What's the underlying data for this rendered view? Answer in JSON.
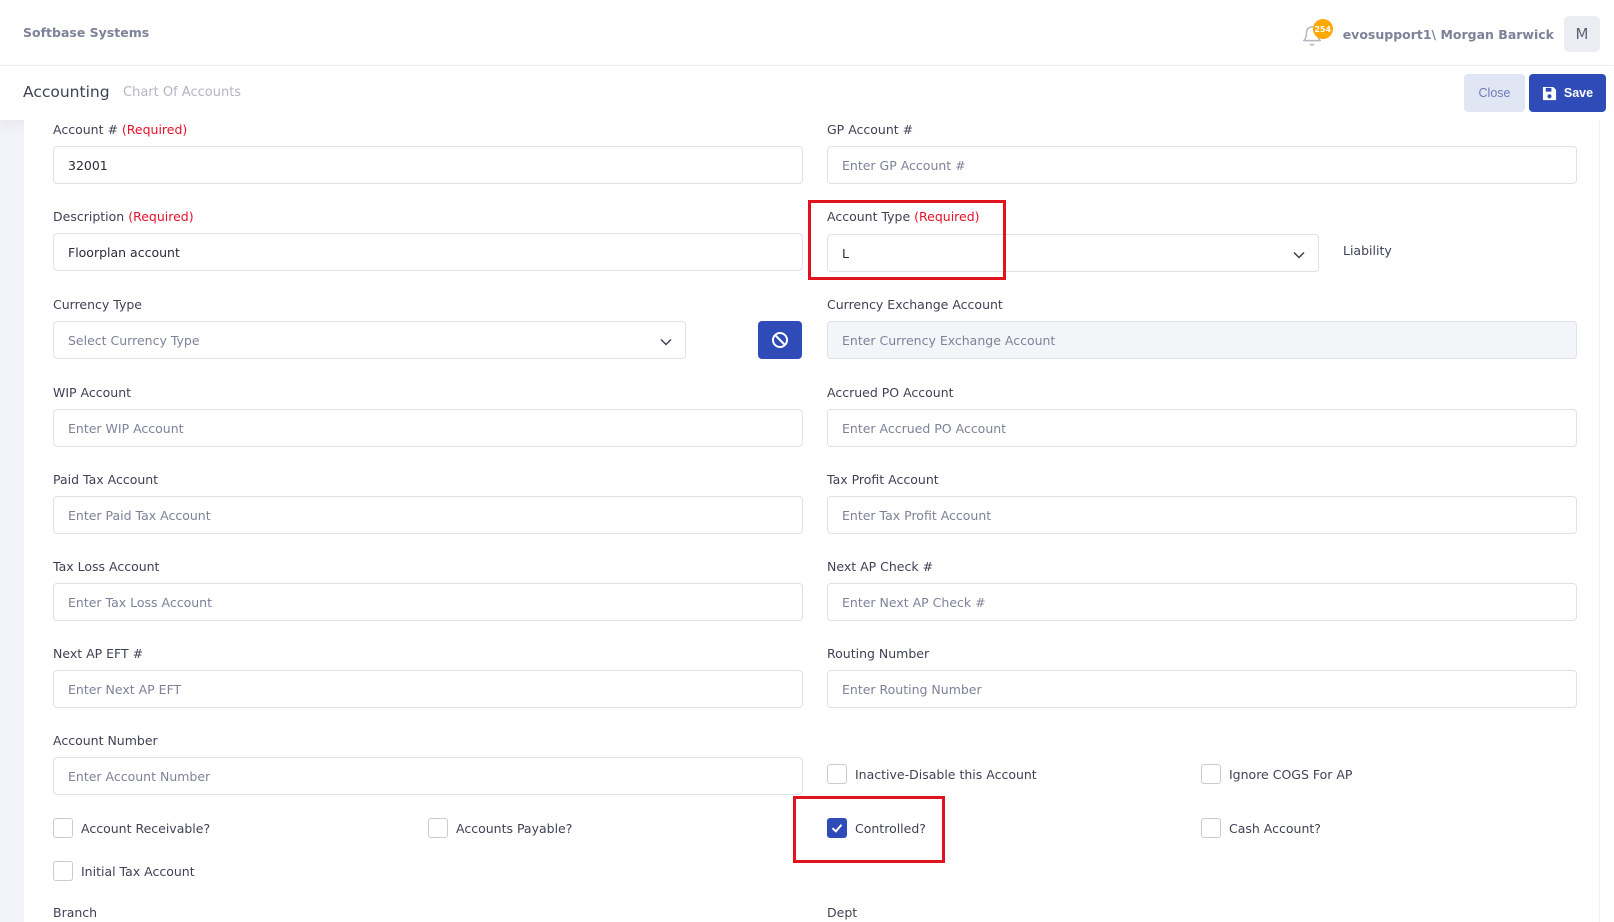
{
  "topbar": {
    "brand": "Softbase Systems",
    "notification_count": "254",
    "username": "evosupport1\\ Morgan Barwick",
    "avatar_letter": "M"
  },
  "subheader": {
    "title": "Accounting",
    "breadcrumb": "Chart Of Accounts",
    "close_label": "Close",
    "save_label": "Save"
  },
  "form": {
    "required_tag": "(Required)",
    "account_number": {
      "label": "Account #",
      "value": "32001"
    },
    "gp_account": {
      "label": "GP Account #",
      "placeholder": "Enter GP Account #"
    },
    "description": {
      "label": "Description",
      "value": "Floorplan account"
    },
    "account_type": {
      "label": "Account Type",
      "value": "L",
      "display": "Liability"
    },
    "currency_type": {
      "label": "Currency Type",
      "placeholder": "Select Currency Type"
    },
    "currency_exchange": {
      "label": "Currency Exchange Account",
      "placeholder": "Enter Currency Exchange Account"
    },
    "wip_account": {
      "label": "WIP Account",
      "placeholder": "Enter WIP Account"
    },
    "accrued_po": {
      "label": "Accrued PO Account",
      "placeholder": "Enter Accrued PO Account"
    },
    "paid_tax": {
      "label": "Paid Tax Account",
      "placeholder": "Enter Paid Tax Account"
    },
    "tax_profit": {
      "label": "Tax Profit Account",
      "placeholder": "Enter Tax Profit Account"
    },
    "tax_loss": {
      "label": "Tax Loss Account",
      "placeholder": "Enter Tax Loss Account"
    },
    "next_ap_check": {
      "label": "Next AP Check #",
      "placeholder": "Enter Next AP Check #"
    },
    "next_ap_eft": {
      "label": "Next AP EFT #",
      "placeholder": "Enter Next AP EFT"
    },
    "routing_number": {
      "label": "Routing Number",
      "placeholder": "Enter Routing Number"
    },
    "account_number_field": {
      "label": "Account Number",
      "placeholder": "Enter Account Number"
    },
    "checkboxes": {
      "inactive": {
        "label": "Inactive-Disable this Account",
        "checked": false
      },
      "ignore_cogs": {
        "label": "Ignore COGS For AP",
        "checked": false
      },
      "account_receivable": {
        "label": "Account Receivable?",
        "checked": false
      },
      "accounts_payable": {
        "label": "Accounts Payable?",
        "checked": false
      },
      "controlled": {
        "label": "Controlled?",
        "checked": true
      },
      "cash_account": {
        "label": "Cash Account?",
        "checked": false
      },
      "initial_tax": {
        "label": "Initial Tax Account",
        "checked": false
      }
    },
    "branch_label": "Branch",
    "dept_label": "Dept"
  },
  "colors": {
    "primary": "#2e4bb8",
    "required": "#e8112d",
    "highlight": "#e0141e",
    "badge": "#ffa800"
  }
}
